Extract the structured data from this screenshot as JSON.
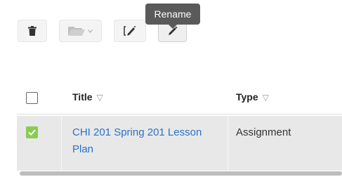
{
  "toolbar": {
    "tooltip": "Rename",
    "buttons": [
      {
        "name": "delete",
        "icon": "trash-icon"
      },
      {
        "name": "move",
        "icon": "folder-open-icon",
        "dropdown": true
      },
      {
        "name": "edit",
        "icon": "edit-icon"
      },
      {
        "name": "rename",
        "icon": "pencil-icon"
      }
    ]
  },
  "table": {
    "columns": [
      "Title",
      "Type"
    ],
    "sort_indicator": "▽",
    "rows": [
      {
        "title": "CHI 201 Spring 201 Lesson Plan",
        "type": "Assignment",
        "checked": true
      }
    ]
  },
  "colors": {
    "link": "#2a72c9",
    "checkbox_checked": "#88cc4f",
    "tooltip_bg": "#5a5a5a",
    "row_selected_bg": "#e8e8e8"
  }
}
